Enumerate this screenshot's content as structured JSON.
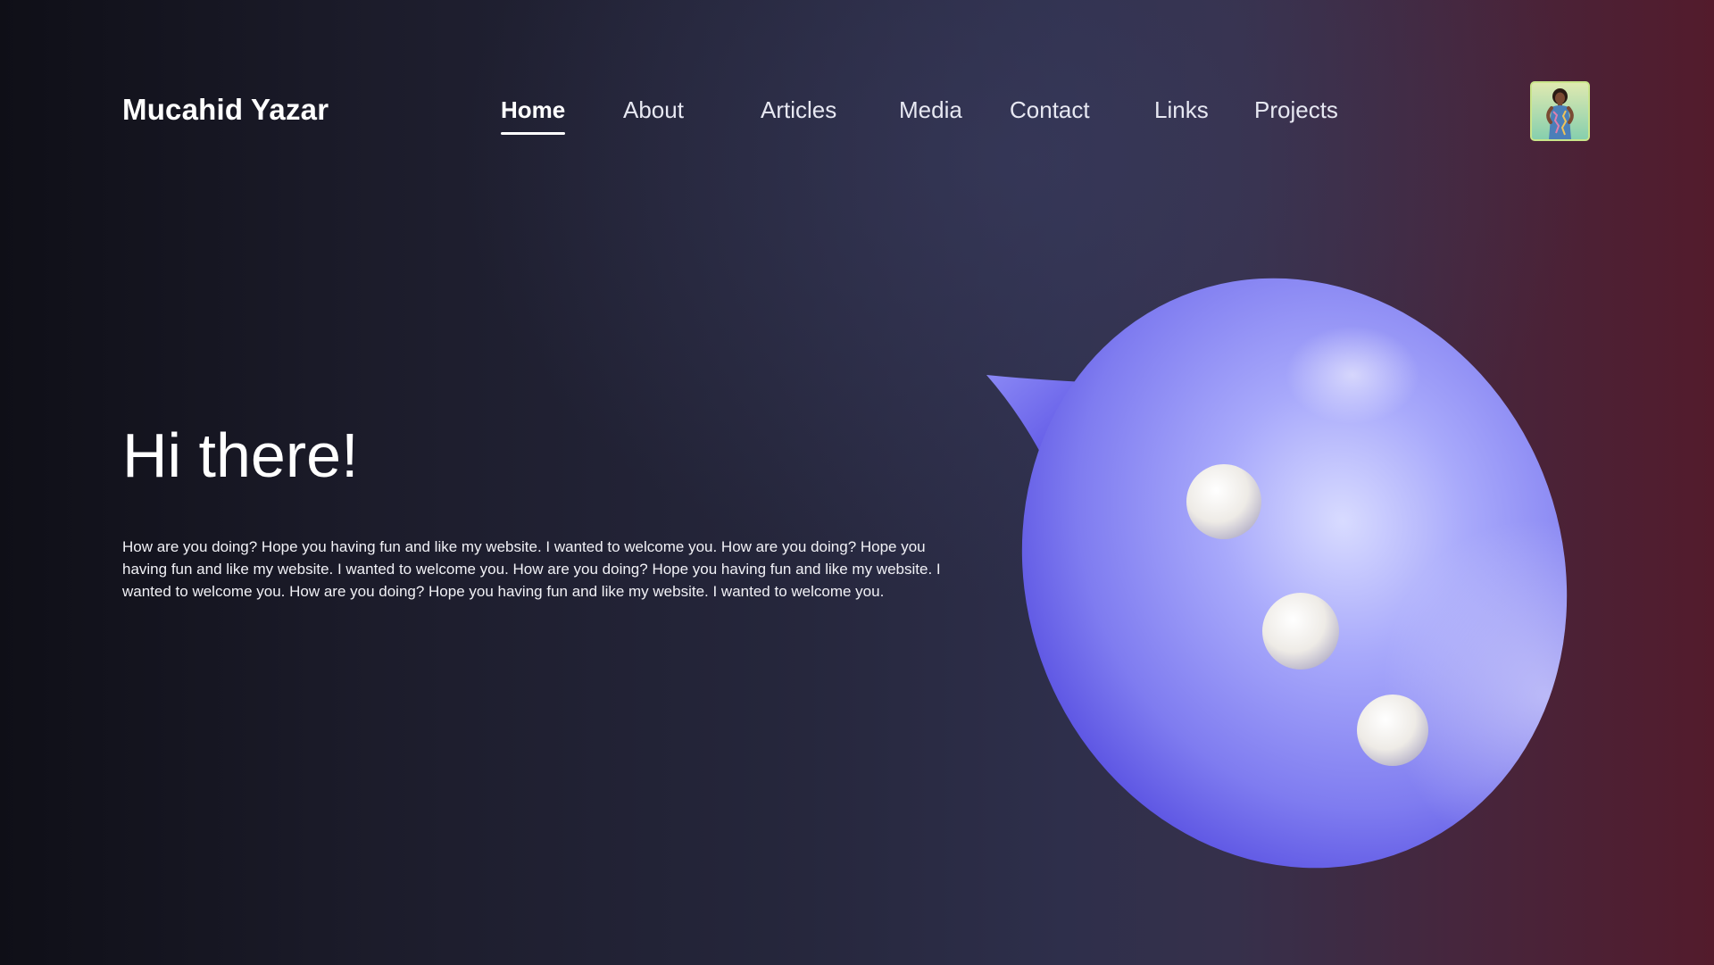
{
  "header": {
    "brand": "Mucahid Yazar",
    "nav": [
      {
        "label": "Home",
        "active": true
      },
      {
        "label": "About",
        "active": false
      },
      {
        "label": "Articles",
        "active": false
      },
      {
        "label": "Media",
        "active": false
      },
      {
        "label": "Contact",
        "active": false
      },
      {
        "label": "Links",
        "active": false
      },
      {
        "label": "Projects",
        "active": false
      }
    ],
    "avatar_icon": "user-avatar-photo"
  },
  "hero": {
    "title": "Hi there!",
    "text": "How are you doing? Hope you having fun and like my website. I wanted to welcome you. How are you doing? Hope you having fun and like my website. I wanted to welcome you. How are you doing? Hope you having fun and like my website. I wanted to welcome you. How are you doing? Hope you having fun and like my website. I wanted to welcome you.",
    "illustration": "chat-bubble-3d-icon"
  },
  "colors": {
    "bubble_main": "#8c8cf2",
    "bubble_light": "#d6d8ff",
    "bubble_dark": "#5b56e6",
    "dot": "#f3f1ee",
    "accent_red": "#531b2c"
  }
}
